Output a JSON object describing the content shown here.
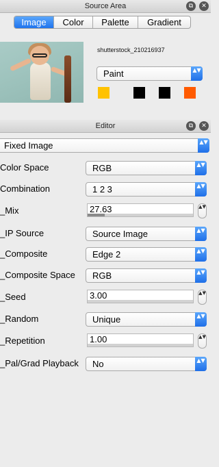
{
  "source_area": {
    "title": "Source Area",
    "window_buttons": {
      "detach": "⧉",
      "close": "✕"
    },
    "tabs": [
      {
        "label": "Image",
        "active": true
      },
      {
        "label": "Color",
        "active": false
      },
      {
        "label": "Palette",
        "active": false
      },
      {
        "label": "Gradient",
        "active": false
      }
    ],
    "filename": "shutterstock_210216937",
    "paint_select": {
      "value": "Paint"
    },
    "swatches": [
      {
        "color": "#ffc200"
      },
      {
        "color": "#000000"
      },
      {
        "color": "#000000"
      },
      {
        "color": "#ff5a00"
      }
    ]
  },
  "editor": {
    "title": "Editor",
    "window_buttons": {
      "detach": "⧉",
      "close": "✕"
    },
    "mode_select": {
      "value": "Fixed Image"
    },
    "rows": {
      "color_space": {
        "label": "Color Space",
        "value": "RGB"
      },
      "combination": {
        "label": "Combination",
        "value": "1 2 3"
      },
      "mix": {
        "label": "_Mix",
        "value": "27.63",
        "level": 0.16
      },
      "ip_source": {
        "label": "_IP Source",
        "value": "Source Image"
      },
      "composite": {
        "label": "_Composite",
        "value": "Edge 2"
      },
      "composite_space": {
        "label": "_Composite Space",
        "value": "RGB"
      },
      "seed": {
        "label": "_Seed",
        "value": "3.00",
        "level": 0.0
      },
      "random": {
        "label": "_Random",
        "value": "Unique"
      },
      "repetition": {
        "label": "_Repetition",
        "value": "1.00",
        "level": 0.0
      },
      "pal_grad_playback": {
        "label": "_Pal/Grad Playback",
        "value": "No"
      }
    }
  },
  "glyphs": {
    "updown": "▲▼"
  }
}
